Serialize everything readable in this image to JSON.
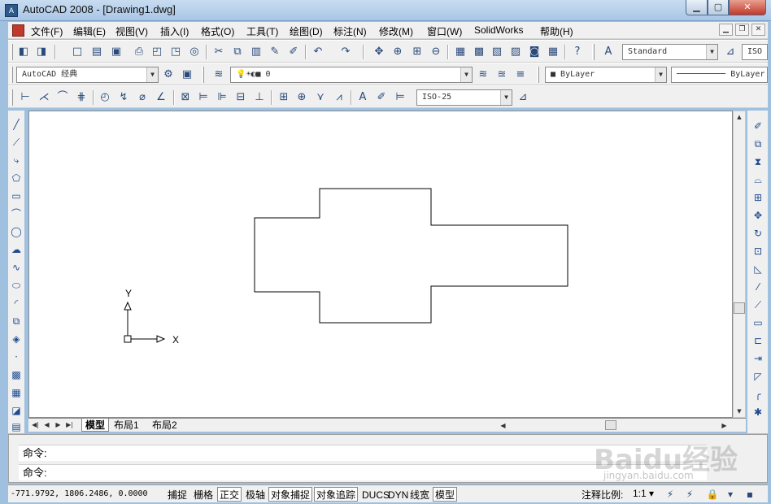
{
  "window": {
    "title": "AutoCAD 2008 - [Drawing1.dwg]",
    "logo": "A"
  },
  "menu": {
    "items": [
      "文件(F)",
      "编辑(E)",
      "视图(V)",
      "插入(I)",
      "格式(O)",
      "工具(T)",
      "绘图(D)",
      "标注(N)",
      "修改(M)",
      "窗口(W)",
      "SolidWorks",
      "帮助(H)"
    ]
  },
  "toolbar": {
    "text_style": "Standard",
    "workspace": "AutoCAD 经典",
    "layer": "0",
    "color": "ByLayer",
    "linetype": "ByLayer",
    "dim_style": "ISO-25",
    "clipped_style": "ISO"
  },
  "ucs": {
    "y_label": "Y",
    "x_label": "X"
  },
  "tabs": {
    "model": "模型",
    "layout1": "布局1",
    "layout2": "布局2"
  },
  "command": {
    "line1": "命令:",
    "line2": "命令:"
  },
  "status": {
    "coords": "-771.9792, 1806.2486, 0.0000",
    "buttons": [
      "捕捉",
      "栅格",
      "正交",
      "极轴",
      "对象捕捉",
      "对象追踪",
      "DUCS",
      "DYN",
      "线宽",
      "模型"
    ],
    "active": [
      "正交",
      "对象捕捉",
      "对象追踪",
      "模型"
    ],
    "scale_label": "注释比例:",
    "scale_value": "1:1 ▾"
  },
  "watermark": {
    "text": "Baidu经验",
    "sub": "jingyan.baidu.com"
  },
  "icons": {
    "left": [
      "line-icon",
      "construction-line-icon",
      "polyline-icon",
      "polygon-icon",
      "rectangle-icon",
      "arc-icon",
      "circle-icon",
      "revision-cloud-icon",
      "spline-icon",
      "ellipse-icon",
      "ellipse-arc-icon",
      "insert-block-icon",
      "make-block-icon",
      "point-icon",
      "hatch-icon",
      "gradient-icon",
      "region-icon",
      "table-icon"
    ],
    "right": [
      "erase-icon",
      "copy-icon",
      "mirror-icon",
      "offset-icon",
      "array-icon",
      "move-icon",
      "rotate-icon",
      "scale-icon",
      "stretch-icon",
      "trim-icon",
      "extend-icon",
      "break-at-point-icon",
      "break-icon",
      "join-icon",
      "chamfer-icon",
      "fillet-icon",
      "explode-icon"
    ]
  },
  "colors": {
    "accent": "#c0392b",
    "canvas": "#ffffff",
    "chrome": "#f0f0f0",
    "titlebar": "#a9c6e6"
  }
}
